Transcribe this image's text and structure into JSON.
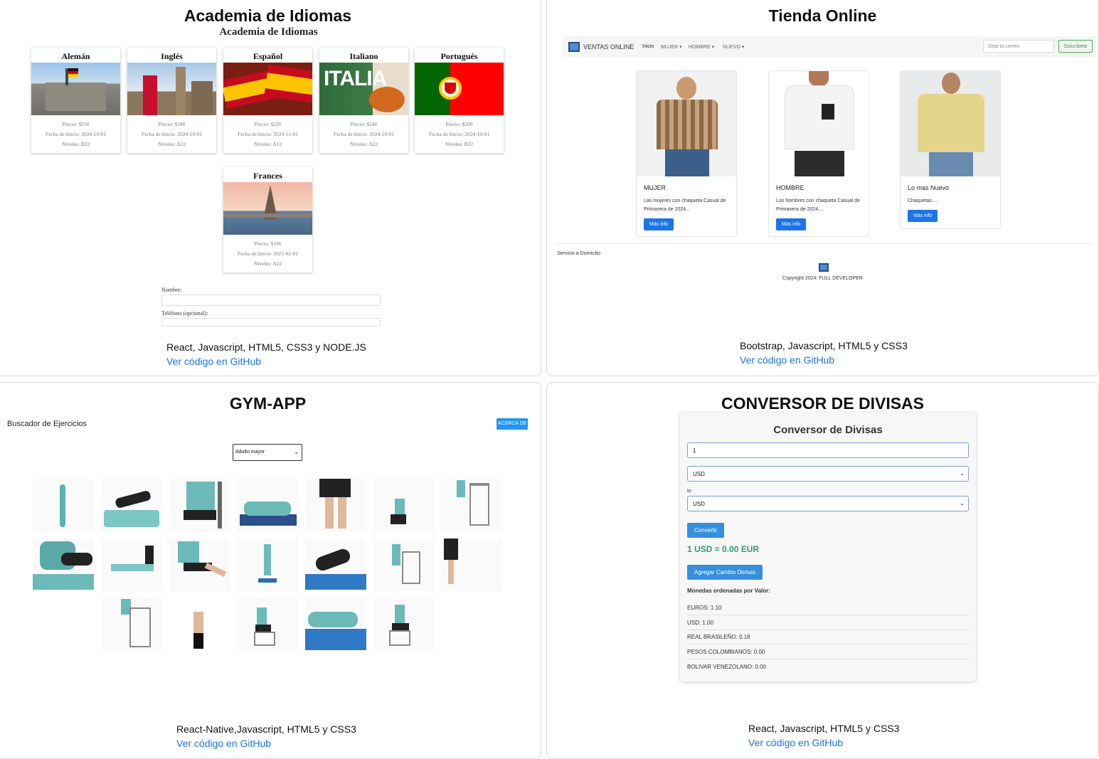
{
  "panels": {
    "academia": {
      "title": "Academia de Idiomas",
      "subtitle": "Academia de Idiomas",
      "cards": [
        {
          "name": "Alemán",
          "precio": "Precio: $250",
          "fecha": "Fecha de Inicio: 2024-10-01",
          "nivel": "Niveles: B22"
        },
        {
          "name": "Inglés",
          "precio": "Precio: $180",
          "fecha": "Fecha de Inicio: 2024-10-01",
          "nivel": "Niveles: A22"
        },
        {
          "name": "Español",
          "precio": "Precio: $220",
          "fecha": "Fecha de Inicio: 2024-11-01",
          "nivel": "Niveles: A12"
        },
        {
          "name": "Italiano",
          "precio": "Precio: $240",
          "fecha": "Fecha de Inicio: 2024-10-01",
          "nivel": "Niveles: A22"
        },
        {
          "name": "Portugués",
          "precio": "Precio: $200",
          "fecha": "Fecha de Inicio: 2024-10-01",
          "nivel": "Niveles: B22"
        },
        {
          "name": "Frances",
          "precio": "Precio: $190",
          "fecha": "Fecha de Inicio: 2025-02-01",
          "nivel": "Niveles: A22"
        }
      ],
      "italia_text": "ITALIA",
      "form_nombre": "Nombre:",
      "form_telefono": "Teléfono (opcional):",
      "tech": "React, Javascript, HTML5, CSS3 y NODE.JS",
      "github": "Ver código en GitHub"
    },
    "tienda": {
      "title": "Tienda Online",
      "brand": "VENTAS ONLINE",
      "nav": [
        "Inicio",
        "MUJER",
        "HOMBRE",
        "NUEVO"
      ],
      "email_placeholder": "Deja tu correo",
      "subscribe": "Suscribete",
      "products": [
        {
          "title": "MUJER",
          "desc": "Las mujeres con chaqueta Casual de Primavera de 2024...",
          "btn": "Más info"
        },
        {
          "title": "HOMBRE",
          "desc": "Los hombres con chaqueta Casual de Primavera de 2024....",
          "btn": "Más info"
        },
        {
          "title": "Lo mas Nuevo",
          "desc": "Chaquetas....",
          "btn": "Más info"
        }
      ],
      "servicio": "Servicio a Domicilio",
      "copyright": "Copyright 2024: FULL DEVELOPER",
      "tech": "Bootstrap, Javascript, HTML5 y CSS3",
      "github": "Ver código en GitHub"
    },
    "gym": {
      "title": "GYM-APP",
      "search_title": "Buscador de Ejercicios",
      "about": "ACERCA DE",
      "select_value": "Adulto mayor",
      "tech": "React-Native,Javascript, HTML5 y CSS3",
      "github": "Ver código en GitHub"
    },
    "conversor": {
      "title": "CONVERSOR DE DIVISAS",
      "heading": "Conversor de Divisas",
      "amount": "1",
      "from": "USD",
      "to_label": "to",
      "to": "USD",
      "convert": "Convertir",
      "result": "1 USD = 0.00 EUR",
      "add": "Agregar Cambio Divisas",
      "list_title": "Monedas ordenadas por Valor:",
      "rates": [
        "EUROS: 1.10",
        "USD: 1.00",
        "REAL BRASILEÑO: 0.18",
        "PESOS COLOMBIANOS: 0.00",
        "BOLIVAR VENEZOLANO: 0.00"
      ],
      "tech": "React, Javascript, HTML5 y CSS3",
      "github": "Ver código en GitHub"
    }
  },
  "colors": {
    "link": "#1a73e8",
    "primary_btn": "#1b74e8",
    "result": "#2e9e6e"
  }
}
